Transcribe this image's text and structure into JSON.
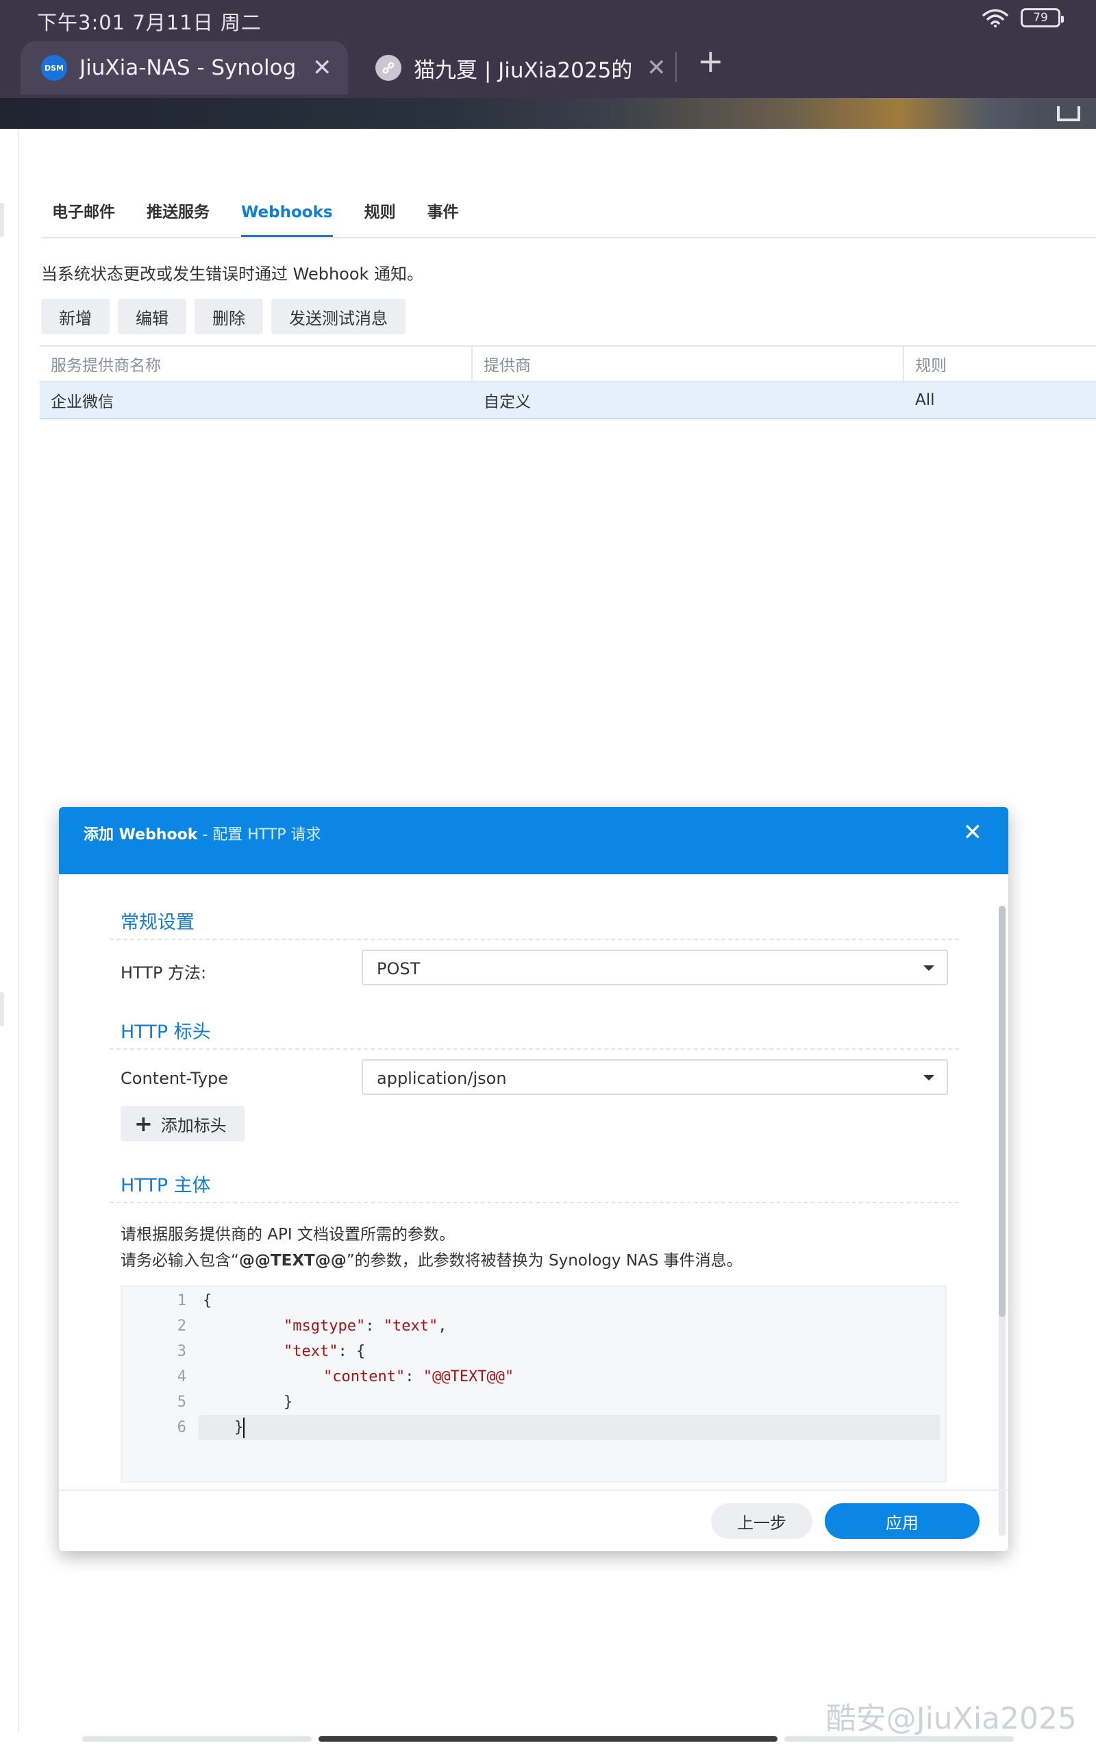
{
  "status_bar": {
    "time": "下午3:01  7月11日 周二",
    "battery": "79"
  },
  "browser": {
    "tabs": [
      {
        "title": "JiuXia-NAS - Synolog…",
        "favicon": "DSM"
      },
      {
        "title": "猫九夏 | JiuXia2025的…"
      }
    ]
  },
  "notification_panel": {
    "tabs": [
      "电子邮件",
      "推送服务",
      "Webhooks",
      "规则",
      "事件"
    ],
    "active_tab": "Webhooks",
    "description": "当系统状态更改或发生错误时通过 Webhook 通知。",
    "toolbar": {
      "add": "新增",
      "edit": "编辑",
      "delete": "删除",
      "send_test": "发送测试消息"
    },
    "table": {
      "columns": [
        "服务提供商名称",
        "提供商",
        "规则"
      ],
      "rows": [
        {
          "name": "企业微信",
          "provider": "自定义",
          "rule": "All"
        }
      ]
    }
  },
  "dialog": {
    "title": "添加 Webhook",
    "subtitle": " - 配置 HTTP 请求",
    "general_section": "常规设置",
    "http_method_label": "HTTP 方法:",
    "http_method_value": "POST",
    "headers_section": "HTTP 标头",
    "content_type_label": "Content-Type",
    "content_type_value": "application/json",
    "add_header_label": "添加标头",
    "body_section": "HTTP 主体",
    "body_note_1": "请根据服务提供商的 API 文档设置所需的参数。",
    "body_note_2_pre": "请务必输入包含“",
    "body_note_2_token": "@@TEXT@@",
    "body_note_2_post": "”的参数，此参数将被替换为 Synology NAS 事件消息。",
    "code": {
      "line_numbers": [
        "1",
        "2",
        "3",
        "4",
        "5",
        "6"
      ],
      "l1": "{",
      "l2_key": "\"msgtype\"",
      "l2_sep": ": ",
      "l2_val": "\"text\"",
      "l2_end": ",",
      "l3_key": "\"text\"",
      "l3_sep": ": {",
      "l4_key": "\"content\"",
      "l4_sep": ": ",
      "l4_val": "\"@@TEXT@@\"",
      "l5": "}",
      "l6": "}"
    },
    "back_label": "上一步",
    "apply_label": "应用"
  },
  "watermark": "酷安@JiuXia2025",
  "colors": {
    "accent": "#0b86e4",
    "tab_active": "#0f7fd6",
    "string": "#a31515",
    "selected_row": "#e4f0fb"
  }
}
